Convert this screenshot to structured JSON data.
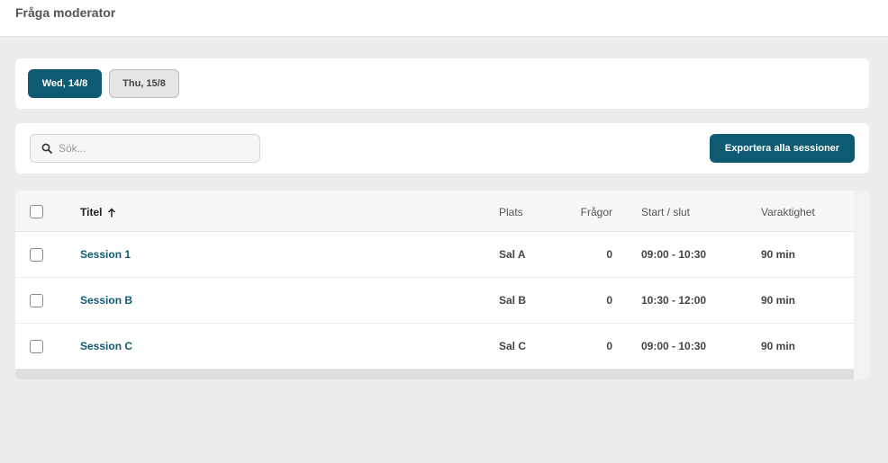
{
  "header": {
    "title": "Fråga moderator"
  },
  "dates": [
    {
      "label": "Wed, 14/8",
      "active": true
    },
    {
      "label": "Thu, 15/8",
      "active": false
    }
  ],
  "search": {
    "placeholder": "Sök...",
    "value": ""
  },
  "export": {
    "label": "Exportera alla sessioner"
  },
  "table": {
    "columns": {
      "title": "Titel",
      "place": "Plats",
      "questions": "Frågor",
      "time": "Start / slut",
      "duration": "Varaktighet"
    },
    "sort": {
      "column": "title",
      "direction": "ascending"
    },
    "rows": [
      {
        "title": "Session 1",
        "place": "Sal A",
        "questions": "0",
        "time": "09:00 - 10:30",
        "duration": "90 min"
      },
      {
        "title": "Session B",
        "place": "Sal B",
        "questions": "0",
        "time": "10:30 - 12:00",
        "duration": "90 min"
      },
      {
        "title": "Session C",
        "place": "Sal C",
        "questions": "0",
        "time": "09:00 - 10:30",
        "duration": "90 min"
      }
    ]
  },
  "colors": {
    "accent": "#0e5a73",
    "background": "#ededed"
  }
}
